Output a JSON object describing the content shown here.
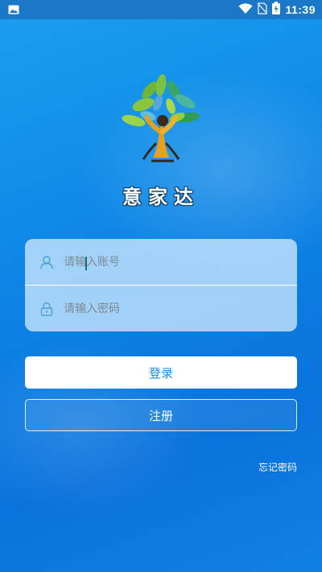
{
  "status_bar": {
    "time": "11:39",
    "icons": [
      "image-icon",
      "wifi-icon",
      "no-sim-icon",
      "battery-charging-icon"
    ]
  },
  "app": {
    "title": "意家达",
    "logo": "tree-person-logo"
  },
  "form": {
    "account_placeholder": "请输入账号",
    "account_value": "",
    "password_placeholder": "请输入密码",
    "password_value": "",
    "account_icon": "user-icon",
    "password_icon": "lock-icon"
  },
  "buttons": {
    "login_label": "登录",
    "register_label": "注册"
  },
  "links": {
    "forgot_password": "忘记密码"
  },
  "colors": {
    "background": "#0e86e6",
    "status_bar": "#1b78c8",
    "login_text": "#1f8be0",
    "field_icon": "#4a9fd8"
  }
}
